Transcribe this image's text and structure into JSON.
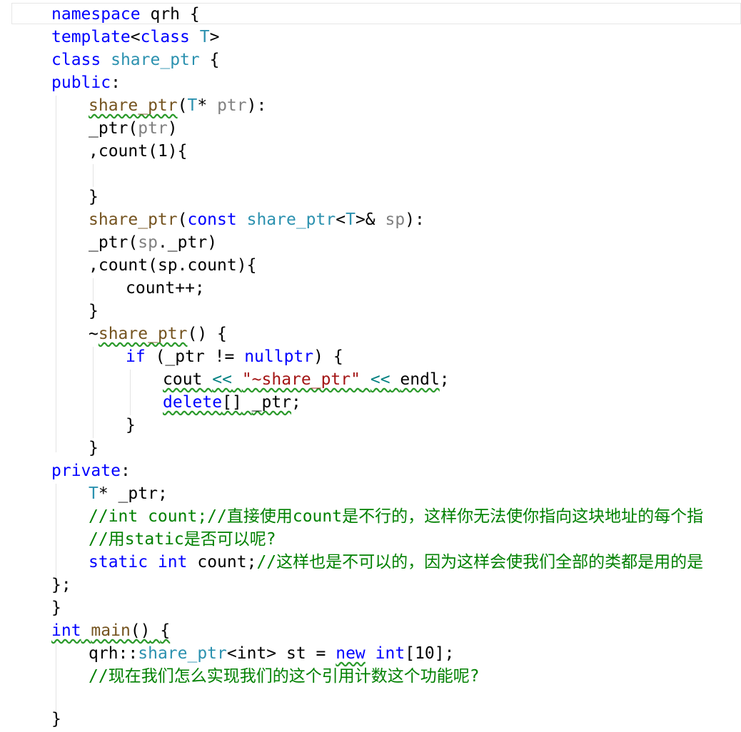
{
  "lines": [
    "namespace qrh {",
    "template<class T>",
    "class share_ptr {",
    "public:",
    "share_ptr(T* ptr):",
    "_ptr(ptr)",
    ",count(1){",
    "",
    "}",
    "share_ptr(const share_ptr<T>& sp):",
    "_ptr(sp._ptr)",
    ",count(sp.count){",
    "count++;",
    "}",
    "~share_ptr() {",
    "if (_ptr != nullptr) {",
    "cout << \"~share_ptr\" << endl;",
    "delete[] _ptr;",
    "}",
    "}",
    "private:",
    "T* _ptr;",
    "//int count;//直接使用count是不行的，这样你无法使你指向这块地址的每个指",
    "//用static是否可以呢?",
    "static int count;//这样也是不可以的，因为这样会使我们全部的类都是用的是",
    "};",
    "}",
    "int main() {",
    "qrh::share_ptr<int> st = new int[10];",
    "//现在我们怎么实现我们的这个引用计数这个功能呢?",
    "",
    "}"
  ],
  "tokens": {
    "l0": [
      "namespace",
      "qrh",
      "{"
    ],
    "l1": [
      "template",
      "<",
      "class",
      "T",
      ">"
    ],
    "l2": [
      "class",
      "share_ptr",
      "{"
    ],
    "l3": [
      "public",
      ":"
    ],
    "l4": [
      "share_ptr",
      "(",
      "T",
      "*",
      "ptr",
      "):"
    ],
    "l5": [
      "_ptr",
      "(",
      "ptr",
      ")"
    ],
    "l6": [
      ",count",
      "(1){"
    ],
    "l8": [
      "}"
    ],
    "l9": [
      "share_ptr",
      "(",
      "const",
      "share_ptr",
      "<",
      "T",
      ">&",
      "sp",
      "):"
    ],
    "l10": [
      "_ptr",
      "(",
      "sp",
      "._ptr)"
    ],
    "l11": [
      ",count",
      "(sp.count){"
    ],
    "l12": [
      "count++;"
    ],
    "l13": [
      "}"
    ],
    "l14": [
      "~",
      "share_ptr",
      "() {"
    ],
    "l15": [
      "if",
      "(_ptr != ",
      "nullptr",
      ") {"
    ],
    "l16": [
      "cout",
      "<<",
      "\"~share_ptr\"",
      "<<",
      "endl",
      ";"
    ],
    "l17": [
      "delete",
      "[]",
      "_ptr",
      ";"
    ],
    "l18": [
      "}"
    ],
    "l19": [
      "}"
    ],
    "l20": [
      "private",
      ":"
    ],
    "l21": [
      "T",
      "* _ptr;"
    ],
    "l22": [
      "//int count;//直接使用count是不行的，这样你无法使你指向这块地址的每个指"
    ],
    "l23": [
      "//用static是否可以呢?"
    ],
    "l24": [
      "static",
      "int",
      "count;",
      "//这样也是不可以的，因为这样会使我们全部的类都是用的是"
    ],
    "l25": [
      "};"
    ],
    "l26": [
      "}"
    ],
    "l27": [
      "int",
      "main",
      "()",
      "{"
    ],
    "l28": [
      "qrh::",
      "share_ptr",
      "<int>",
      "st = ",
      "new",
      "int",
      "[10];"
    ],
    "l29": [
      "//现在我们怎么实现我们的这个引用计数这个功能呢?"
    ],
    "l31": [
      "}"
    ]
  },
  "colors": {
    "keyword": "#0000ff",
    "type": "#2b91af",
    "parameter": "#808080",
    "comment": "#008000",
    "string": "#a31515",
    "squiggle": "#2b9a2b"
  }
}
